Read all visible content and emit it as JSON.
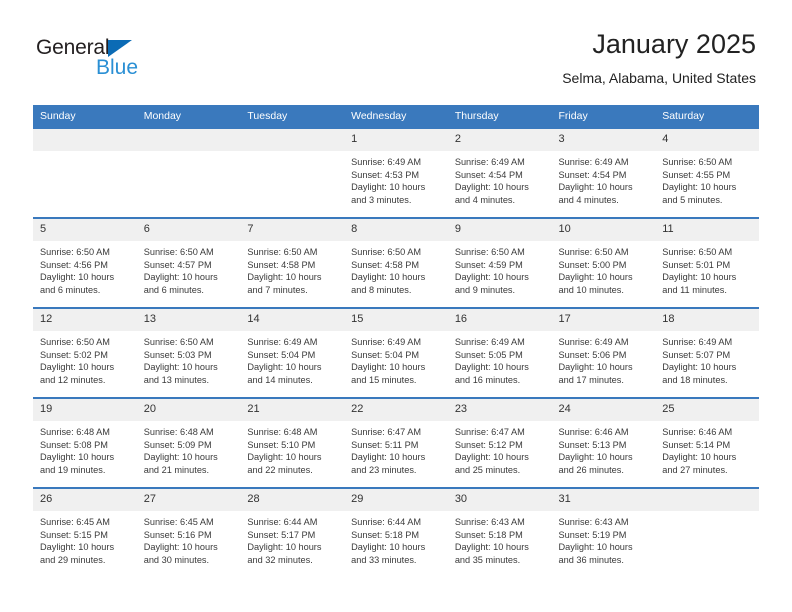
{
  "brand": {
    "name_part1": "General",
    "name_part2": "Blue",
    "triangle_icon": "triangle-icon",
    "accent_dark": "#0b6bb5",
    "accent_light": "#2a8fd4"
  },
  "header": {
    "title": "January 2025",
    "subtitle": "Selma, Alabama, United States"
  },
  "theme": {
    "header_blue": "#3a79bd",
    "daynum_bg": "#f0f0f0",
    "text": "#3a3a3a"
  },
  "calendar": {
    "weekday_headers": [
      "Sunday",
      "Monday",
      "Tuesday",
      "Wednesday",
      "Thursday",
      "Friday",
      "Saturday"
    ],
    "weeks": [
      [
        {
          "day": "",
          "sunrise": "",
          "sunset": "",
          "daylight": ""
        },
        {
          "day": "",
          "sunrise": "",
          "sunset": "",
          "daylight": ""
        },
        {
          "day": "",
          "sunrise": "",
          "sunset": "",
          "daylight": ""
        },
        {
          "day": "1",
          "sunrise": "Sunrise: 6:49 AM",
          "sunset": "Sunset: 4:53 PM",
          "daylight": "Daylight: 10 hours and 3 minutes."
        },
        {
          "day": "2",
          "sunrise": "Sunrise: 6:49 AM",
          "sunset": "Sunset: 4:54 PM",
          "daylight": "Daylight: 10 hours and 4 minutes."
        },
        {
          "day": "3",
          "sunrise": "Sunrise: 6:49 AM",
          "sunset": "Sunset: 4:54 PM",
          "daylight": "Daylight: 10 hours and 4 minutes."
        },
        {
          "day": "4",
          "sunrise": "Sunrise: 6:50 AM",
          "sunset": "Sunset: 4:55 PM",
          "daylight": "Daylight: 10 hours and 5 minutes."
        }
      ],
      [
        {
          "day": "5",
          "sunrise": "Sunrise: 6:50 AM",
          "sunset": "Sunset: 4:56 PM",
          "daylight": "Daylight: 10 hours and 6 minutes."
        },
        {
          "day": "6",
          "sunrise": "Sunrise: 6:50 AM",
          "sunset": "Sunset: 4:57 PM",
          "daylight": "Daylight: 10 hours and 6 minutes."
        },
        {
          "day": "7",
          "sunrise": "Sunrise: 6:50 AM",
          "sunset": "Sunset: 4:58 PM",
          "daylight": "Daylight: 10 hours and 7 minutes."
        },
        {
          "day": "8",
          "sunrise": "Sunrise: 6:50 AM",
          "sunset": "Sunset: 4:58 PM",
          "daylight": "Daylight: 10 hours and 8 minutes."
        },
        {
          "day": "9",
          "sunrise": "Sunrise: 6:50 AM",
          "sunset": "Sunset: 4:59 PM",
          "daylight": "Daylight: 10 hours and 9 minutes."
        },
        {
          "day": "10",
          "sunrise": "Sunrise: 6:50 AM",
          "sunset": "Sunset: 5:00 PM",
          "daylight": "Daylight: 10 hours and 10 minutes."
        },
        {
          "day": "11",
          "sunrise": "Sunrise: 6:50 AM",
          "sunset": "Sunset: 5:01 PM",
          "daylight": "Daylight: 10 hours and 11 minutes."
        }
      ],
      [
        {
          "day": "12",
          "sunrise": "Sunrise: 6:50 AM",
          "sunset": "Sunset: 5:02 PM",
          "daylight": "Daylight: 10 hours and 12 minutes."
        },
        {
          "day": "13",
          "sunrise": "Sunrise: 6:50 AM",
          "sunset": "Sunset: 5:03 PM",
          "daylight": "Daylight: 10 hours and 13 minutes."
        },
        {
          "day": "14",
          "sunrise": "Sunrise: 6:49 AM",
          "sunset": "Sunset: 5:04 PM",
          "daylight": "Daylight: 10 hours and 14 minutes."
        },
        {
          "day": "15",
          "sunrise": "Sunrise: 6:49 AM",
          "sunset": "Sunset: 5:04 PM",
          "daylight": "Daylight: 10 hours and 15 minutes."
        },
        {
          "day": "16",
          "sunrise": "Sunrise: 6:49 AM",
          "sunset": "Sunset: 5:05 PM",
          "daylight": "Daylight: 10 hours and 16 minutes."
        },
        {
          "day": "17",
          "sunrise": "Sunrise: 6:49 AM",
          "sunset": "Sunset: 5:06 PM",
          "daylight": "Daylight: 10 hours and 17 minutes."
        },
        {
          "day": "18",
          "sunrise": "Sunrise: 6:49 AM",
          "sunset": "Sunset: 5:07 PM",
          "daylight": "Daylight: 10 hours and 18 minutes."
        }
      ],
      [
        {
          "day": "19",
          "sunrise": "Sunrise: 6:48 AM",
          "sunset": "Sunset: 5:08 PM",
          "daylight": "Daylight: 10 hours and 19 minutes."
        },
        {
          "day": "20",
          "sunrise": "Sunrise: 6:48 AM",
          "sunset": "Sunset: 5:09 PM",
          "daylight": "Daylight: 10 hours and 21 minutes."
        },
        {
          "day": "21",
          "sunrise": "Sunrise: 6:48 AM",
          "sunset": "Sunset: 5:10 PM",
          "daylight": "Daylight: 10 hours and 22 minutes."
        },
        {
          "day": "22",
          "sunrise": "Sunrise: 6:47 AM",
          "sunset": "Sunset: 5:11 PM",
          "daylight": "Daylight: 10 hours and 23 minutes."
        },
        {
          "day": "23",
          "sunrise": "Sunrise: 6:47 AM",
          "sunset": "Sunset: 5:12 PM",
          "daylight": "Daylight: 10 hours and 25 minutes."
        },
        {
          "day": "24",
          "sunrise": "Sunrise: 6:46 AM",
          "sunset": "Sunset: 5:13 PM",
          "daylight": "Daylight: 10 hours and 26 minutes."
        },
        {
          "day": "25",
          "sunrise": "Sunrise: 6:46 AM",
          "sunset": "Sunset: 5:14 PM",
          "daylight": "Daylight: 10 hours and 27 minutes."
        }
      ],
      [
        {
          "day": "26",
          "sunrise": "Sunrise: 6:45 AM",
          "sunset": "Sunset: 5:15 PM",
          "daylight": "Daylight: 10 hours and 29 minutes."
        },
        {
          "day": "27",
          "sunrise": "Sunrise: 6:45 AM",
          "sunset": "Sunset: 5:16 PM",
          "daylight": "Daylight: 10 hours and 30 minutes."
        },
        {
          "day": "28",
          "sunrise": "Sunrise: 6:44 AM",
          "sunset": "Sunset: 5:17 PM",
          "daylight": "Daylight: 10 hours and 32 minutes."
        },
        {
          "day": "29",
          "sunrise": "Sunrise: 6:44 AM",
          "sunset": "Sunset: 5:18 PM",
          "daylight": "Daylight: 10 hours and 33 minutes."
        },
        {
          "day": "30",
          "sunrise": "Sunrise: 6:43 AM",
          "sunset": "Sunset: 5:18 PM",
          "daylight": "Daylight: 10 hours and 35 minutes."
        },
        {
          "day": "31",
          "sunrise": "Sunrise: 6:43 AM",
          "sunset": "Sunset: 5:19 PM",
          "daylight": "Daylight: 10 hours and 36 minutes."
        },
        {
          "day": "",
          "sunrise": "",
          "sunset": "",
          "daylight": ""
        }
      ]
    ]
  }
}
